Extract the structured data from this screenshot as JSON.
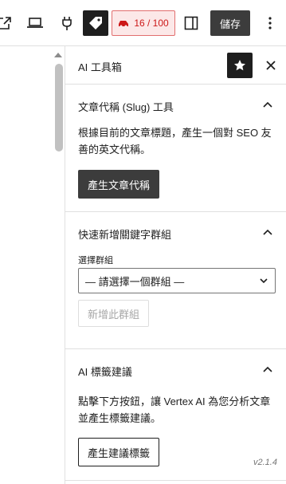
{
  "toolbar": {
    "counter_text": "16 / 100",
    "save_label": "儲存"
  },
  "panel": {
    "title": "AI 工具箱",
    "sections": [
      {
        "title": "文章代稱 (Slug) 工具",
        "description": "根據目前的文章標題，產生一個對 SEO 友善的英文代稱。",
        "button": "產生文章代稱"
      },
      {
        "title": "快速新增關鍵字群組",
        "select_label": "選擇群組",
        "select_value": "— 請選擇一個群組 —",
        "button": "新增此群組"
      },
      {
        "title": "AI 標籤建議",
        "description": "點擊下方按鈕，讓 Vertex AI 為您分析文章並產生標籤建議。",
        "button": "產生建議標籤",
        "version": "v2.1.4"
      }
    ]
  },
  "icons": {
    "external": "external-link-icon",
    "preview": "laptop-icon",
    "plugin": "plug-icon",
    "tag": "tag-icon",
    "counter": "car-icon",
    "sidebar": "sidebar-icon",
    "more": "more-vertical-icon",
    "pin": "star-icon",
    "close": "close-icon",
    "chevron": "chevron-up-icon"
  },
  "colors": {
    "accent_dark": "#1e1e1e",
    "button_dark": "#3c3c3c",
    "counter_bg": "#fce8e8",
    "counter_text": "#cc1818"
  }
}
